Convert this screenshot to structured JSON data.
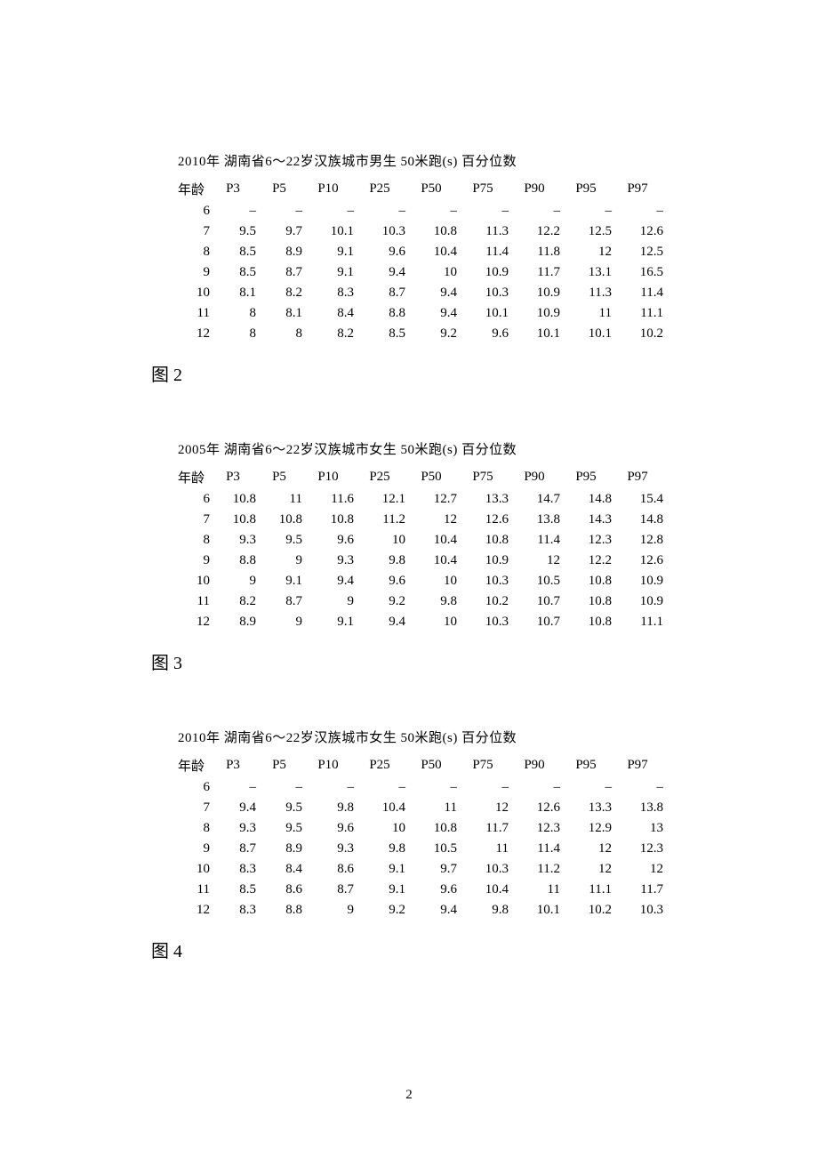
{
  "page_number": "2",
  "tables": [
    {
      "title": "2010年 湖南省6～22岁汉族城市男生 50米跑(s) 百分位数",
      "caption": "图 2",
      "headers": [
        "年龄",
        "P3",
        "P5",
        "P10",
        "P25",
        "P50",
        "P75",
        "P90",
        "P95",
        "P97"
      ],
      "chart_data": {
        "type": "table",
        "title": "2010年 湖南省6～22岁汉族城市男生 50米跑(s) 百分位数",
        "columns": [
          "年龄",
          "P3",
          "P5",
          "P10",
          "P25",
          "P50",
          "P75",
          "P90",
          "P95",
          "P97"
        ],
        "rows": [
          [
            "6",
            "–",
            "–",
            "–",
            "–",
            "–",
            "–",
            "–",
            "–",
            "–"
          ],
          [
            "7",
            "9.5",
            "9.7",
            "10.1",
            "10.3",
            "10.8",
            "11.3",
            "12.2",
            "12.5",
            "12.6"
          ],
          [
            "8",
            "8.5",
            "8.9",
            "9.1",
            "9.6",
            "10.4",
            "11.4",
            "11.8",
            "12",
            "12.5"
          ],
          [
            "9",
            "8.5",
            "8.7",
            "9.1",
            "9.4",
            "10",
            "10.9",
            "11.7",
            "13.1",
            "16.5"
          ],
          [
            "10",
            "8.1",
            "8.2",
            "8.3",
            "8.7",
            "9.4",
            "10.3",
            "10.9",
            "11.3",
            "11.4"
          ],
          [
            "11",
            "8",
            "8.1",
            "8.4",
            "8.8",
            "9.4",
            "10.1",
            "10.9",
            "11",
            "11.1"
          ],
          [
            "12",
            "8",
            "8",
            "8.2",
            "8.5",
            "9.2",
            "9.6",
            "10.1",
            "10.1",
            "10.2"
          ]
        ]
      }
    },
    {
      "title": "2005年 湖南省6～22岁汉族城市女生 50米跑(s) 百分位数",
      "caption": "图 3",
      "headers": [
        "年龄",
        "P3",
        "P5",
        "P10",
        "P25",
        "P50",
        "P75",
        "P90",
        "P95",
        "P97"
      ],
      "chart_data": {
        "type": "table",
        "title": "2005年 湖南省6～22岁汉族城市女生 50米跑(s) 百分位数",
        "columns": [
          "年龄",
          "P3",
          "P5",
          "P10",
          "P25",
          "P50",
          "P75",
          "P90",
          "P95",
          "P97"
        ],
        "rows": [
          [
            "6",
            "10.8",
            "11",
            "11.6",
            "12.1",
            "12.7",
            "13.3",
            "14.7",
            "14.8",
            "15.4"
          ],
          [
            "7",
            "10.8",
            "10.8",
            "10.8",
            "11.2",
            "12",
            "12.6",
            "13.8",
            "14.3",
            "14.8"
          ],
          [
            "8",
            "9.3",
            "9.5",
            "9.6",
            "10",
            "10.4",
            "10.8",
            "11.4",
            "12.3",
            "12.8"
          ],
          [
            "9",
            "8.8",
            "9",
            "9.3",
            "9.8",
            "10.4",
            "10.9",
            "12",
            "12.2",
            "12.6"
          ],
          [
            "10",
            "9",
            "9.1",
            "9.4",
            "9.6",
            "10",
            "10.3",
            "10.5",
            "10.8",
            "10.9"
          ],
          [
            "11",
            "8.2",
            "8.7",
            "9",
            "9.2",
            "9.8",
            "10.2",
            "10.7",
            "10.8",
            "10.9"
          ],
          [
            "12",
            "8.9",
            "9",
            "9.1",
            "9.4",
            "10",
            "10.3",
            "10.7",
            "10.8",
            "11.1"
          ]
        ]
      }
    },
    {
      "title": "2010年 湖南省6～22岁汉族城市女生 50米跑(s) 百分位数",
      "caption": "图 4",
      "headers": [
        "年龄",
        "P3",
        "P5",
        "P10",
        "P25",
        "P50",
        "P75",
        "P90",
        "P95",
        "P97"
      ],
      "chart_data": {
        "type": "table",
        "title": "2010年 湖南省6～22岁汉族城市女生 50米跑(s) 百分位数",
        "columns": [
          "年龄",
          "P3",
          "P5",
          "P10",
          "P25",
          "P50",
          "P75",
          "P90",
          "P95",
          "P97"
        ],
        "rows": [
          [
            "6",
            "–",
            "–",
            "–",
            "–",
            "–",
            "–",
            "–",
            "–",
            "–"
          ],
          [
            "7",
            "9.4",
            "9.5",
            "9.8",
            "10.4",
            "11",
            "12",
            "12.6",
            "13.3",
            "13.8"
          ],
          [
            "8",
            "9.3",
            "9.5",
            "9.6",
            "10",
            "10.8",
            "11.7",
            "12.3",
            "12.9",
            "13"
          ],
          [
            "9",
            "8.7",
            "8.9",
            "9.3",
            "9.8",
            "10.5",
            "11",
            "11.4",
            "12",
            "12.3"
          ],
          [
            "10",
            "8.3",
            "8.4",
            "8.6",
            "9.1",
            "9.7",
            "10.3",
            "11.2",
            "12",
            "12"
          ],
          [
            "11",
            "8.5",
            "8.6",
            "8.7",
            "9.1",
            "9.6",
            "10.4",
            "11",
            "11.1",
            "11.7"
          ],
          [
            "12",
            "8.3",
            "8.8",
            "9",
            "9.2",
            "9.4",
            "9.8",
            "10.1",
            "10.2",
            "10.3"
          ]
        ]
      }
    }
  ]
}
